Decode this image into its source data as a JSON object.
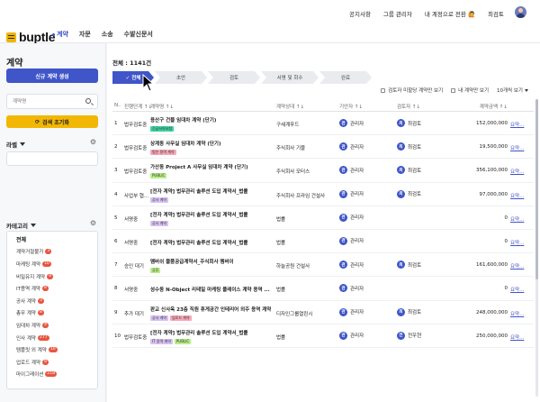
{
  "header": {
    "logo_text": "buptle",
    "nav": [
      {
        "label": "계약",
        "active": true
      },
      {
        "label": "자문",
        "active": false
      },
      {
        "label": "소송",
        "active": false
      },
      {
        "label": "수발신문서",
        "active": false
      }
    ],
    "util": [
      "공지사항",
      "그룹 관리자",
      "내 계정으로 전환 🙋",
      "최검토"
    ]
  },
  "sidebar": {
    "title": "계약",
    "new_button": "신규 계약 생성",
    "search_placeholder": "계약명",
    "reset_button": "검색 초기화",
    "label_heading": "라벨",
    "category_heading": "카테고리",
    "categories": [
      {
        "label": "전체",
        "count": ""
      },
      {
        "label": "계약거절불가",
        "count": "3"
      },
      {
        "label": "마케팅 계약",
        "count": "10"
      },
      {
        "label": "비밀유지 계약",
        "count": "8"
      },
      {
        "label": "IT용역 계약",
        "count": "8"
      },
      {
        "label": "공사 계약",
        "count": "3"
      },
      {
        "label": "총무 계약",
        "count": "8"
      },
      {
        "label": "임대차 계약",
        "count": "4"
      },
      {
        "label": "인사 계약",
        "count": "277"
      },
      {
        "label": "템플릿 외 계약",
        "count": "10"
      },
      {
        "label": "업로드 계약",
        "count": "8"
      },
      {
        "label": "마이그레이션",
        "count": "218"
      }
    ]
  },
  "main": {
    "total": "전체 : 1141건",
    "steps": [
      "✓ 전체",
      "초안",
      "검토",
      "서명 및 회수",
      "완료"
    ],
    "filters": {
      "unassigned": "검토자 미할당 계약만 보기",
      "mine": "내 계약만 보기",
      "page_size": "10개씩 보기"
    },
    "columns": [
      "N..",
      "진행단계 ↑↓",
      "계약명 ↑↓",
      "계약상대 ↑↓",
      "기안자 ↑↓",
      "검토자 ↑↓",
      "계약금액 ↑↓"
    ],
    "rows": [
      {
        "no": "1",
        "stage": "법무검토중",
        "name": "용산구 건물 임대차 계약 (단기)",
        "tags": [
          {
            "text": "긴급서약요청",
            "color": "#3fd3a2"
          }
        ],
        "party": "구세계푸드",
        "creator": {
          "initial": "관",
          "name": "관리자",
          "color": "#3f55c8"
        },
        "reviewer": {
          "initial": "최",
          "name": "최검토",
          "color": "#3f55c8"
        },
        "amount": "152,000,000",
        "view": "요약..."
      },
      {
        "no": "2",
        "stage": "법무검토중",
        "name": "상계동 사무실 임대차 계약 (단기)",
        "tags": [
          {
            "text": "법은 용역 계약",
            "color": "#f8a7b8"
          }
        ],
        "party": "주식회사 기블",
        "creator": {
          "initial": "관",
          "name": "관리자",
          "color": "#3f55c8"
        },
        "reviewer": {
          "initial": "최",
          "name": "최검토",
          "color": "#3f55c8"
        },
        "amount": "19,500,000",
        "view": "요약..."
      },
      {
        "no": "3",
        "stage": "법무검토중",
        "name": "가산동 Project A 사무실 임대차 계약 (단기)",
        "tags": [
          {
            "text": "PUBLIC",
            "color": "#b8ee88"
          }
        ],
        "party": "주식회사 모터스",
        "creator": {
          "initial": "관",
          "name": "관리자",
          "color": "#3f55c8"
        },
        "reviewer": {
          "initial": "최",
          "name": "최검토",
          "color": "#3f55c8"
        },
        "amount": "356,100,000",
        "view": "요약..."
      },
      {
        "no": "4",
        "stage": "사업부 협...",
        "name": "[전자 계약] 법무관리 솔루션 도입 계약서_법률",
        "tags": [
          {
            "text": "공사 계약",
            "color": "#d7c2f4"
          }
        ],
        "party": "주식회사 프라임 건설사",
        "creator": {
          "initial": "관",
          "name": "관리자",
          "color": "#3f55c8"
        },
        "reviewer": {
          "initial": "최",
          "name": "최검토",
          "color": "#3f55c8"
        },
        "amount": "97,000,000",
        "view": "요약..."
      },
      {
        "no": "5",
        "stage": "서명중",
        "name": "[전자 계약] 법무관리 솔루션 도입 계약서_법률",
        "tags": [
          {
            "text": "공사 계약",
            "color": "#d7c2f4"
          }
        ],
        "party": "법률",
        "creator": {
          "initial": "관",
          "name": "관리자",
          "color": "#3f55c8"
        },
        "reviewer": {
          "initial": "",
          "name": "",
          "color": ""
        },
        "amount": "0",
        "view": "요약..."
      },
      {
        "no": "6",
        "stage": "서명중",
        "name": "[전자 계약] 법무관리 솔루션 도입 계약서_법률",
        "tags": [],
        "party": "법률",
        "creator": {
          "initial": "관",
          "name": "관리자",
          "color": "#3f55c8"
        },
        "reviewer": {
          "initial": "",
          "name": "",
          "color": ""
        },
        "amount": "0",
        "view": "요약..."
      },
      {
        "no": "7",
        "stage": "승인 대기",
        "name": "멤버쉬 물품공급계약서_주식회사 멤버이",
        "tags": [
          {
            "text": "공휴",
            "color": "#b8ee88"
          }
        ],
        "party": "하늘공원 건설사",
        "creator": {
          "initial": "관",
          "name": "관리자",
          "color": "#3f55c8"
        },
        "reviewer": {
          "initial": "최",
          "name": "최검토",
          "color": "#3f55c8"
        },
        "amount": "161,600,000",
        "view": "요약..."
      },
      {
        "no": "8",
        "stage": "서명중",
        "name": "성수동 N-Object 리테일 마케팅 플레이스 계약 용역 ...",
        "tags": [],
        "party": "법률",
        "creator": {
          "initial": "관",
          "name": "관리자",
          "color": "#3f55c8"
        },
        "reviewer": {
          "initial": "",
          "name": "",
          "color": ""
        },
        "amount": "0",
        "view": "요약..."
      },
      {
        "no": "9",
        "stage": "추가 대기",
        "name": "판교 신사옥 23층 직원 휴게공간 인테리어 외주 용역 계약",
        "tags": [
          {
            "text": "공사 계약",
            "color": "#d7c2f4"
          },
          {
            "text": "업로드 계약",
            "color": "#f8a7b8"
          }
        ],
        "party": "디자인그룹열린시",
        "creator": {
          "initial": "관",
          "name": "관리자",
          "color": "#3f55c8"
        },
        "reviewer": {
          "initial": "최",
          "name": "최검토",
          "color": "#3f55c8"
        },
        "amount": "248,000,000",
        "view": "요약..."
      },
      {
        "no": "10",
        "stage": "법무검토중",
        "name": "[전자 계약] 법무관리 솔루션 도입 계약서_법률",
        "tags": [
          {
            "text": "IT 용역 계약",
            "color": "#d7c2f4"
          },
          {
            "text": "PUBLIC",
            "color": "#b8ee88"
          }
        ],
        "party": "법률",
        "creator": {
          "initial": "관",
          "name": "관리자",
          "color": "#3f55c8"
        },
        "reviewer": {
          "initial": "전",
          "name": "전우현",
          "color": "#3f55c8"
        },
        "amount": "250,000,000",
        "view": "요약..."
      }
    ]
  }
}
